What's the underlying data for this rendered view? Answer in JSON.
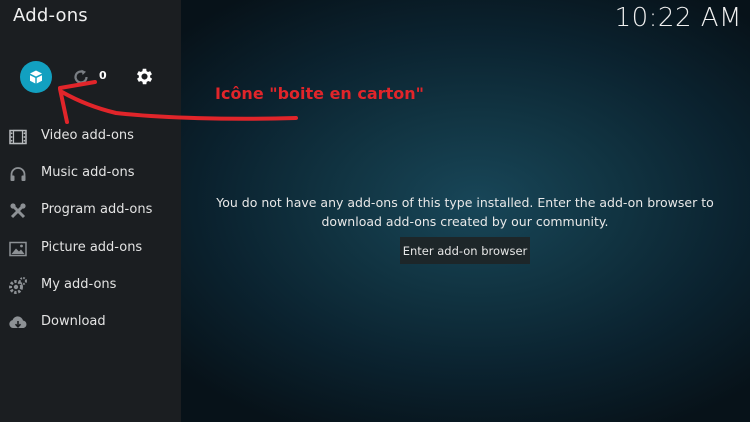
{
  "header": {
    "title": "Add-ons",
    "clock": "10:22 AM"
  },
  "toolbar": {
    "box_icon": "cardboard-box-icon",
    "refresh_icon": "refresh-icon",
    "refresh_count": "0",
    "settings_icon": "gear-icon"
  },
  "sidebar": {
    "items": [
      {
        "label": "Video add-ons",
        "icon": "film-strip-icon"
      },
      {
        "label": "Music add-ons",
        "icon": "headphones-icon"
      },
      {
        "label": "Program add-ons",
        "icon": "tools-icon"
      },
      {
        "label": "Picture add-ons",
        "icon": "picture-icon"
      },
      {
        "label": "My add-ons",
        "icon": "gears-icon"
      },
      {
        "label": "Download",
        "icon": "cloud-download-icon"
      }
    ]
  },
  "annotation": {
    "text": "Icône \"boite en carton\"",
    "color": "#e1252a"
  },
  "main": {
    "message": "You do not have any add-ons of this type installed. Enter the add-on browser to download add-ons created by our community.",
    "browser_button": "Enter add-on browser"
  },
  "colors": {
    "accent": "#12a0c0",
    "sidebar": "#1b1e21",
    "annotation": "#e1252a"
  }
}
